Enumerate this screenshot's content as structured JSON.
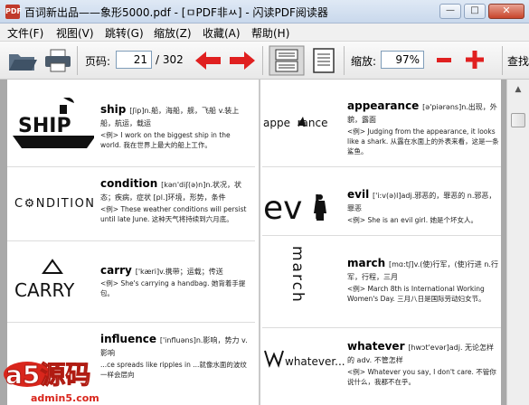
{
  "window": {
    "title": "百词新出品——象形5000.pdf - [ㅁPDF非ㅆ] - 闪读PDF阅读器",
    "app_icon_text": "PDF",
    "min_glyph": "—",
    "max_glyph": "□",
    "close_glyph": "✕"
  },
  "menu": [
    "文件(F)",
    "视图(V)",
    "跳转(G)",
    "缩放(Z)",
    "收藏(A)",
    "帮助(H)"
  ],
  "toolbar": {
    "page_label": "页码:",
    "page_value": "21",
    "page_total": "/ 302",
    "zoom_label": "缩放:",
    "zoom_value": "97%",
    "search_label": "查找"
  },
  "colors": {
    "arrow_red": "#e02020",
    "titlebar_blue": "#c9d8ec"
  },
  "entries_left": [
    {
      "word": "ship",
      "phon": "[ʃip]n.船，海船，舰，飞船 v.装上船，航运，载运",
      "ex": "<例> I work on the biggest ship in the world. 我在世界上最大的船上工作。",
      "logo": "SHIP"
    },
    {
      "word": "condition",
      "phon": "[kən'diʃ(ə)n]n.状况，状态；疾病，症状 [pl.]环境，形势，条件",
      "ex": "<例> These weather conditions will persist until late June. 这种天气将持续到六月底。",
      "logo": "C⚙NDITION"
    },
    {
      "word": "carry",
      "phon": "['kæri]v.携带；运载；传送",
      "ex": "<例> She's carrying a handbag. 她背着手提包。",
      "logo": "CARRY"
    },
    {
      "word": "influence",
      "phon": "['influəns]n.影响，势力 v.影响",
      "ex": "...ce spreads like ripples in ...就像水面的波纹一样会层向",
      "logo": ""
    }
  ],
  "entries_right": [
    {
      "word": "appearance",
      "phon": "[ə'piərəns]n.出现，外貌，露面",
      "ex": "<例> Judging from the appearance, it looks like a shark. 从露在水面上的外表来看，这是一条鲨鱼。",
      "logo": "appe  rance"
    },
    {
      "word": "evil",
      "phon": "['i:v(ə)l]adj.邪恶的，罪恶的 n.邪恶，罪恶",
      "ex": "<例> She is an evil girl. 她是个坏女人。",
      "logo": "ev l"
    },
    {
      "word": "march",
      "phon": "[mɑ:tʃ]v.(使)行军，(使)行进 n.行军，行程，三月",
      "ex": "<例> March 8th is International Working Women's Day. 三月八日是国际劳动妇女节。",
      "logo": "march"
    },
    {
      "word": "whatever",
      "phon": "[hwɔt'evər]adj. 无论怎样的 adv. 不管怎样",
      "ex": "<例> Whatever you say, I don't care. 不管你说什么，我都不在乎。",
      "logo": "whatever..."
    }
  ],
  "watermark": {
    "brand": "a5源码",
    "url": "admin5.com"
  }
}
